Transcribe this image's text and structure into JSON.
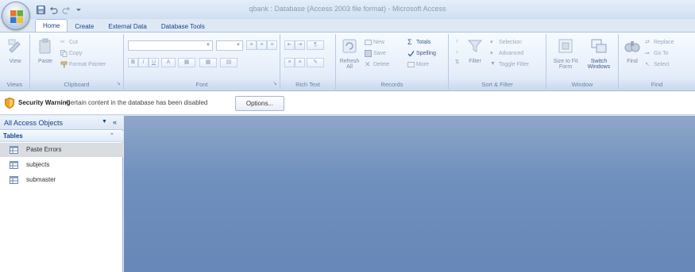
{
  "app": {
    "title": "qbank : Database (Access 2003 file format) - Microsoft Access"
  },
  "quick_access": [
    {
      "icon": "save-icon"
    },
    {
      "icon": "undo-icon"
    },
    {
      "icon": "redo-icon"
    },
    {
      "icon": "customize-icon"
    }
  ],
  "tabs": [
    {
      "label": "Home",
      "active": true
    },
    {
      "label": "Create",
      "active": false
    },
    {
      "label": "External Data",
      "active": false
    },
    {
      "label": "Database Tools",
      "active": false
    }
  ],
  "ribbon": {
    "views": {
      "label": "Views",
      "view_label": "View"
    },
    "clipboard": {
      "label": "Clipboard",
      "paste_label": "Paste",
      "cut_label": "Cut",
      "copy_label": "Copy",
      "format_painter_label": "Format Painter"
    },
    "font": {
      "label": "Font",
      "bold": "B",
      "italic": "I",
      "underline": "U",
      "font_color": "A"
    },
    "rich_text": {
      "label": "Rich Text"
    },
    "records": {
      "label": "Records",
      "refresh_label": "Refresh All",
      "new_label": "New",
      "save_label": "Save",
      "delete_label": "Delete",
      "totals_label": "Totals",
      "spelling_label": "Spelling",
      "more_label": "More"
    },
    "sort_filter": {
      "label": "Sort & Filter",
      "filter_label": "Filter",
      "selection_label": "Selection",
      "advanced_label": "Advanced",
      "toggle_filter_label": "Toggle Filter"
    },
    "window": {
      "label": "Window",
      "size_to_fit_label": "Size to Fit Form",
      "switch_windows_label": "Switch Windows"
    },
    "find": {
      "label": "Find",
      "find_label": "Find",
      "replace_label": "Replace",
      "goto_label": "Go To",
      "select_label": "Select"
    }
  },
  "security_bar": {
    "title": "Security Warning",
    "message": "Certain content in the database has been disabled",
    "options_label": "Options..."
  },
  "nav_pane": {
    "title": "All Access Objects",
    "group_title": "Tables",
    "items": [
      {
        "label": "Paste Errors",
        "selected": true
      },
      {
        "label": "subjects",
        "selected": false
      },
      {
        "label": "submaster",
        "selected": false
      }
    ]
  },
  "colors": {
    "accent": "#15428b",
    "workspace": "#6f8fbd",
    "ribbon": "#e6eefa"
  }
}
